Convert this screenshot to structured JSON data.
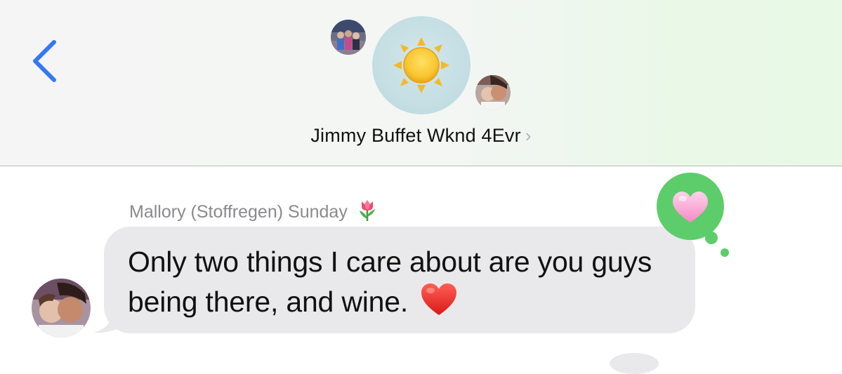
{
  "header": {
    "group_name": "Jimmy Buffet Wknd 4Evr",
    "chevron": "›",
    "group_icon": "sun-icon",
    "back_icon": "chevron-left-icon"
  },
  "conversation": {
    "message": {
      "sender": "Mallory (Stoffregen)",
      "day": "Sunday",
      "sender_emoji": "tulip-icon",
      "text": "Only two things I care about are you guys being there, and wine.",
      "trailing_emoji": "red-heart-icon",
      "reaction": "heart-tapback-icon"
    }
  },
  "colors": {
    "accent_blue": "#3b82f6",
    "bubble_gray": "#e9e9eb",
    "tapback_green": "#5ccd6a",
    "meta_gray": "#8a8a8e"
  }
}
